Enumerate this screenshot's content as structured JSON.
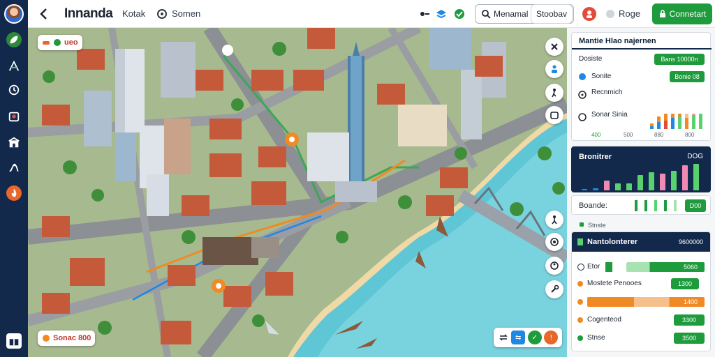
{
  "app": {
    "title": "Innanda",
    "nav1": "Kotak",
    "nav2": "Somen"
  },
  "topbar": {
    "search_value": "Menamal",
    "chip_label": "Stoobav",
    "toggle_label": "Roge",
    "cta_label": "Connetart"
  },
  "rail": {
    "icons": [
      "leaf-icon",
      "compass-icon",
      "clock-icon",
      "building-icon",
      "store-icon",
      "route-icon",
      "flame-icon",
      "gift-icon"
    ]
  },
  "map": {
    "top_badge": "ueo",
    "bottom_badge": "Sonac 800"
  },
  "panel": {
    "header": "Mantie Hlao najernen",
    "rows": [
      {
        "label": "Dosiste",
        "value": "Bans 10000n"
      },
      {
        "label": "Sonite",
        "value": "Bonie 08"
      },
      {
        "label": "Recnmich",
        "value": ""
      },
      {
        "label": "Sonar Sinia",
        "value": ""
      }
    ],
    "axis_ticks": [
      "400",
      "500",
      "880",
      "800"
    ],
    "summary_title": "Bronitrer",
    "summary_value": "DOG",
    "sub_label": "Boande:",
    "sub_value": "D00",
    "section_caption": "Stnste",
    "section2_title": "Nantolonterer",
    "section2_value": "9600000",
    "list": [
      {
        "label": "Etor",
        "value": "5060"
      },
      {
        "label": "Mostete Penooes",
        "value": "1300"
      },
      {
        "label": "",
        "value": "1400"
      },
      {
        "label": "Cogenteod",
        "value": "3300"
      },
      {
        "label": "Stnse",
        "value": "3500"
      }
    ]
  },
  "colors": {
    "accent_green": "#1e9b3c",
    "accent_orange": "#f08a24",
    "navy": "#13294b"
  }
}
